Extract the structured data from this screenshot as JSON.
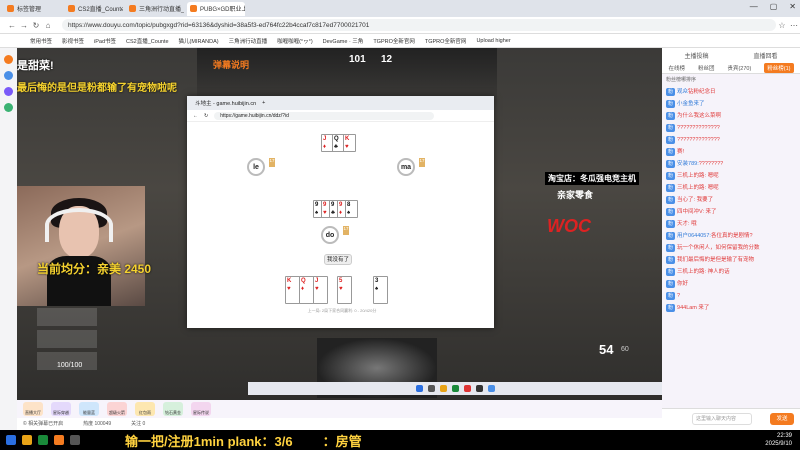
{
  "browser": {
    "tabs": [
      "标签管理",
      "CS2直播_CounterStrike直播_C",
      "三角洲行动直播_三角洲行动",
      "PUBG×GD职业上线"
    ],
    "url": "https://www.douyu.com/topic/pubgxgd?rid=63136&dyshid=38a5f3-ed764fc22b4ccaf7c817ed7700021701",
    "bookmarks": [
      "常用书签",
      "影视书签",
      "iPad书签",
      "CS2直播_Counte",
      "猫儿(MIRANDA)",
      "三角洲行动直播",
      "咖喱咖喱(°ヮ°)",
      "DevGame · 三角",
      "TGPRO全新官网",
      "TGPRO全新官网",
      "Upload higher"
    ]
  },
  "stream": {
    "top_overlay_1": "是甜菜!",
    "top_overlay_2": "最后悔的是但是粉都输了有宠物啦呢",
    "orange_label": "弹幕说明",
    "score": "101",
    "score_sep": "12",
    "bottom_overlay": "当前均分：亲美 2450",
    "shop_text": "淘宝店：冬瓜强电竞主机",
    "tiktok_text": "亲家零食",
    "brand_logo": "WOC",
    "hp": "100/100",
    "ammo": "54",
    "ammo_total": "60"
  },
  "embedded_browser": {
    "tab": "斗地主 - game.huibijin.cn",
    "url": "https://game.huibijin.cn/ddz/?id",
    "players": [
      {
        "name": "le",
        "count": "17"
      },
      {
        "name": "ma",
        "count": "17"
      },
      {
        "name": "do",
        "count": "17"
      }
    ],
    "pass_button": "我没有了",
    "footer": "上一局: 2局下家合同赢利: 0 - 20/420分"
  },
  "right_panel": {
    "header": [
      "主播投稿",
      "直播回看"
    ],
    "tabs": [
      "在线榜",
      "粉丝团",
      "贵宾(270)",
      "粉丝榜(1)"
    ],
    "sub": "粉丝榜哪排序",
    "chat": [
      {
        "badge": "粉",
        "nick": "观众",
        "text": "钻粉纪念日"
      },
      {
        "badge": "粉",
        "nick": "小金鱼来了",
        "text": ""
      },
      {
        "badge": "粉",
        "nick": "",
        "text": "为什么我这么菜啊"
      },
      {
        "badge": "粉",
        "nick": "",
        "text": "??????????????"
      },
      {
        "badge": "粉",
        "nick": "",
        "text": "??????????????"
      },
      {
        "badge": "粉",
        "nick": "",
        "text": "赛!"
      },
      {
        "badge": "粉",
        "nick": "安装789:",
        "text": "????????"
      },
      {
        "badge": "粉",
        "nick": "",
        "text": "三机上的路: 嗯呢"
      },
      {
        "badge": "粉",
        "nick": "",
        "text": "三机上的路: 嗯呢"
      },
      {
        "badge": "粉",
        "nick": "",
        "text": "当心了: 我要了"
      },
      {
        "badge": "粉",
        "nick": "",
        "text": "四中间冲V: 来了"
      },
      {
        "badge": "粉",
        "nick": "",
        "text": "天才: 哦"
      },
      {
        "badge": "粉",
        "nick": "用户0644057:",
        "text": "各位真的是剧情?"
      },
      {
        "badge": "粉",
        "nick": "",
        "text": "玩一个休闲人，如何保留我的分数"
      },
      {
        "badge": "粉",
        "nick": "",
        "text": "我们最后悔的是但是输了有宠物"
      },
      {
        "badge": "粉",
        "nick": "",
        "text": "三机上的路: 神人的话"
      },
      {
        "badge": "粉",
        "nick": "",
        "text": "你好"
      },
      {
        "badge": "粉",
        "nick": "",
        "text": "?"
      },
      {
        "badge": "粉",
        "nick": "",
        "text": "944Lam 来了"
      }
    ],
    "input_placeholder": "这里输入聊天内容",
    "send": "发送"
  },
  "statusbar": {
    "left": "© 相关弹幕已开启",
    "viewers": "热度 100049",
    "follow": "关注 0"
  },
  "gifts": [
    "直播大厅",
    "星际穿越",
    "能量蓝",
    "超级火箭",
    "红包雨",
    "钻石黄金",
    "星际传说"
  ],
  "marquee": "输一把/注册1min plank：3/6",
  "marquee2": "：房管",
  "clock": {
    "time": "22:39",
    "date": "2025/9/10"
  }
}
